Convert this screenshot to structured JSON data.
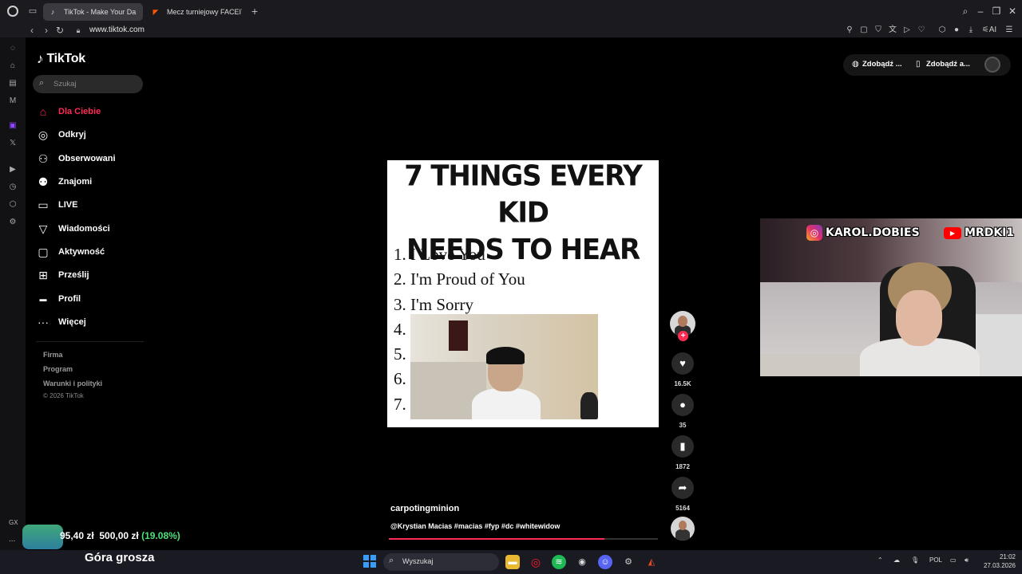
{
  "browser": {
    "tabs": [
      {
        "label": "TikTok - Make Your Da",
        "active": true
      },
      {
        "label": "Mecz turniejowy FACEIT -",
        "active": false
      }
    ],
    "url": "www.tiktok.com",
    "extension_icons": [
      "pin-icon",
      "snapshot-icon",
      "shield-icon",
      "play-icon",
      "heart-icon",
      "extensions-icon",
      "profile-icon",
      "download-icon",
      "ai-icon",
      "menu-icon"
    ]
  },
  "sidebar": {
    "brand": "TikTok",
    "search_placeholder": "Szukaj",
    "items": [
      {
        "label": "Dla Ciebie",
        "icon": "home-icon",
        "active": true
      },
      {
        "label": "Odkryj",
        "icon": "compass-icon"
      },
      {
        "label": "Obserwowani",
        "icon": "following-icon"
      },
      {
        "label": "Znajomi",
        "icon": "friends-icon"
      },
      {
        "label": "LIVE",
        "icon": "live-icon"
      },
      {
        "label": "Wiadomości",
        "icon": "messages-icon"
      },
      {
        "label": "Aktywność",
        "icon": "activity-icon"
      },
      {
        "label": "Prześlij",
        "icon": "upload-icon"
      },
      {
        "label": "Profil",
        "icon": "profile-icon"
      },
      {
        "label": "Więcej",
        "icon": "more-icon"
      }
    ],
    "footer": {
      "company": "Firma",
      "program": "Program",
      "terms": "Warunki i polityki",
      "copyright": "© 2026 TikTok"
    }
  },
  "header": {
    "btn1": "Zdobądź ...",
    "btn2": "Zdobądź a..."
  },
  "video": {
    "title_line1": "7 THINGS EVERY KID",
    "title_line2": "NEEDS TO HEAR",
    "list": [
      "1. I Love You",
      "2. I'm Proud of You",
      "3. I'm Sorry",
      "4.",
      "5.",
      "6.",
      "7."
    ],
    "author": "carpotingminion",
    "description": "@Krystian Macias #macias #fyp #dc #whitewidow",
    "progress": 0.8
  },
  "actions": {
    "likes": "16.5K",
    "comments": "35",
    "saves": "1872",
    "shares": "5164"
  },
  "overlay": {
    "instagram": "KAROL.DOBIES",
    "youtube": "MRDKI1",
    "goal_current": "95,40 zł",
    "goal_target": "500,00 zł",
    "goal_percent": "(19.08%)",
    "goal_name": "Góra grosza",
    "gx": "GX",
    "dots": "..."
  },
  "taskbar": {
    "search": "Wyszukaj",
    "lang": "POL",
    "time": "21:02",
    "date": "27.03.2026"
  },
  "colors": {
    "accent": "#fe2c55",
    "goal_green": "#4ee07a"
  }
}
